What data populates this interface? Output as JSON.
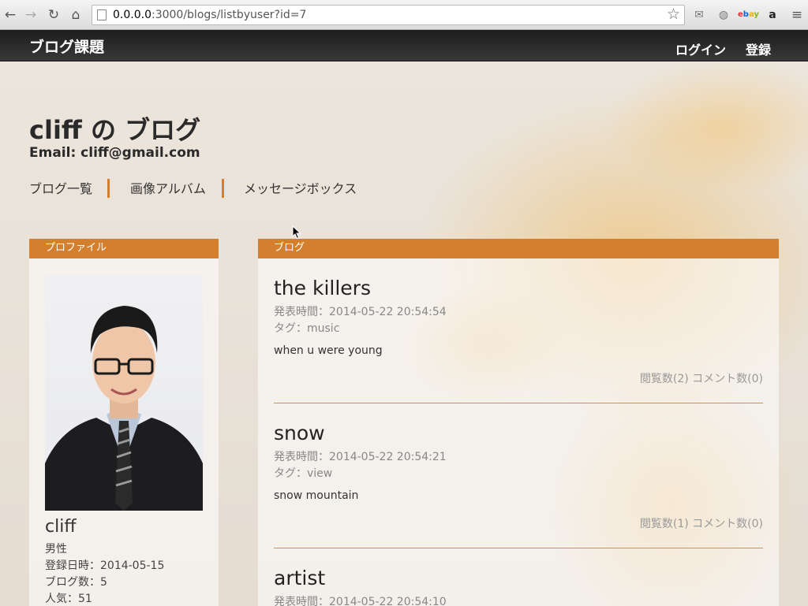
{
  "browser": {
    "url_host": "0.0.0.0",
    "url_rest": ":3000/blogs/listbyuser?id=7"
  },
  "header": {
    "site_title": "ブログ課題",
    "login": "ログイン",
    "register": "登録"
  },
  "blog": {
    "title": "cliff の ブログ",
    "email": "Email: cliff@gmail.com",
    "tabs": [
      "ブログ一覧",
      "画像アルバム",
      "メッセージボックス"
    ]
  },
  "profile": {
    "heading": "プロファイル",
    "name": "cliff",
    "gender": "男性",
    "registered": "登録日時：2014-05-15",
    "blog_count": "ブログ数：5",
    "popularity": "人気：51"
  },
  "blog_section": {
    "heading": "ブログ",
    "posts": [
      {
        "title": "the killers",
        "posted": "発表時間：2014-05-22 20:54:54",
        "tag": "タグ：music",
        "body": "when u were young",
        "stats": "閲覧数(2) コメント数(0)"
      },
      {
        "title": "snow",
        "posted": "発表時間：2014-05-22 20:54:21",
        "tag": "タグ：view",
        "body": "snow mountain",
        "stats": "閲覧数(1) コメント数(0)"
      },
      {
        "title": "artist",
        "posted": "発表時間：2014-05-22 20:54:10"
      }
    ]
  },
  "colors": {
    "accent": "#d47f2e",
    "header_bg": "#2a2a2a"
  }
}
